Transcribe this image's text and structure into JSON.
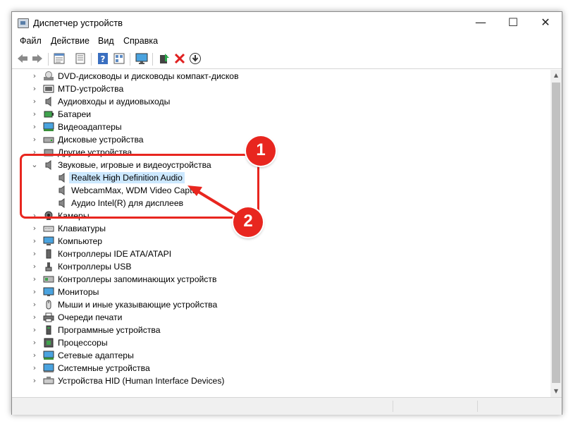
{
  "window": {
    "title": "Диспетчер устройств",
    "controls": {
      "minimize": "—",
      "maximize": "☐",
      "close": "✕"
    }
  },
  "menu": [
    "Файл",
    "Действие",
    "Вид",
    "Справка"
  ],
  "toolbar": [
    "back-arrow-icon",
    "forward-arrow-icon",
    "properties-icon",
    "list-icon",
    "help-icon",
    "view-icon",
    "monitor-icon",
    "update-driver-icon",
    "remove-device-icon",
    "download-icon"
  ],
  "tree": {
    "root_label": "",
    "categories": [
      {
        "label": "DVD-дисководы и дисководы компакт-дисков",
        "icon": "dvd-icon",
        "expanded": false
      },
      {
        "label": "MTD-устройства",
        "icon": "mtd-icon",
        "expanded": false
      },
      {
        "label": "Аудиовходы и аудиовыходы",
        "icon": "speaker-icon",
        "expanded": false
      },
      {
        "label": "Батареи",
        "icon": "battery-icon",
        "expanded": false
      },
      {
        "label": "Видеоадаптеры",
        "icon": "display-adapter-icon",
        "expanded": false
      },
      {
        "label": "Дисковые устройства",
        "icon": "disk-icon",
        "expanded": false
      },
      {
        "label": "Другие устройства",
        "icon": "other-device-icon",
        "expanded": false
      },
      {
        "label": "Звуковые, игровые и видеоустройства",
        "icon": "speaker-icon",
        "expanded": true,
        "children": [
          {
            "label": "Realtek High Definition Audio",
            "icon": "speaker-icon",
            "selected": true
          },
          {
            "label": "WebcamMax, WDM Video Captu",
            "icon": "speaker-icon",
            "selected": false
          },
          {
            "label": "Аудио Intel(R) для дисплеев",
            "icon": "speaker-icon",
            "selected": false
          }
        ]
      },
      {
        "label": "Камеры",
        "icon": "camera-icon",
        "expanded": false
      },
      {
        "label": "Клавиатуры",
        "icon": "keyboard-icon",
        "expanded": false
      },
      {
        "label": "Компьютер",
        "icon": "computer-icon",
        "expanded": false
      },
      {
        "label": "Контроллеры IDE ATA/ATAPI",
        "icon": "ide-controller-icon",
        "expanded": false
      },
      {
        "label": "Контроллеры USB",
        "icon": "usb-icon",
        "expanded": false
      },
      {
        "label": "Контроллеры запоминающих устройств",
        "icon": "storage-controller-icon",
        "expanded": false
      },
      {
        "label": "Мониторы",
        "icon": "monitor-icon",
        "expanded": false
      },
      {
        "label": "Мыши и иные указывающие устройства",
        "icon": "mouse-icon",
        "expanded": false
      },
      {
        "label": "Очереди печати",
        "icon": "printer-icon",
        "expanded": false
      },
      {
        "label": "Программные устройства",
        "icon": "software-device-icon",
        "expanded": false
      },
      {
        "label": "Процессоры",
        "icon": "processor-icon",
        "expanded": false
      },
      {
        "label": "Сетевые адаптеры",
        "icon": "network-adapter-icon",
        "expanded": false
      },
      {
        "label": "Системные устройства",
        "icon": "system-device-icon",
        "expanded": false
      },
      {
        "label": "Устройства HID (Human Interface Devices)",
        "icon": "hid-icon",
        "expanded": false
      }
    ]
  },
  "annotations": {
    "badge1": "1",
    "badge2": "2",
    "color": "#e8261f"
  },
  "colors": {
    "selection": "#cce8ff",
    "accent_red": "#e8261f"
  }
}
